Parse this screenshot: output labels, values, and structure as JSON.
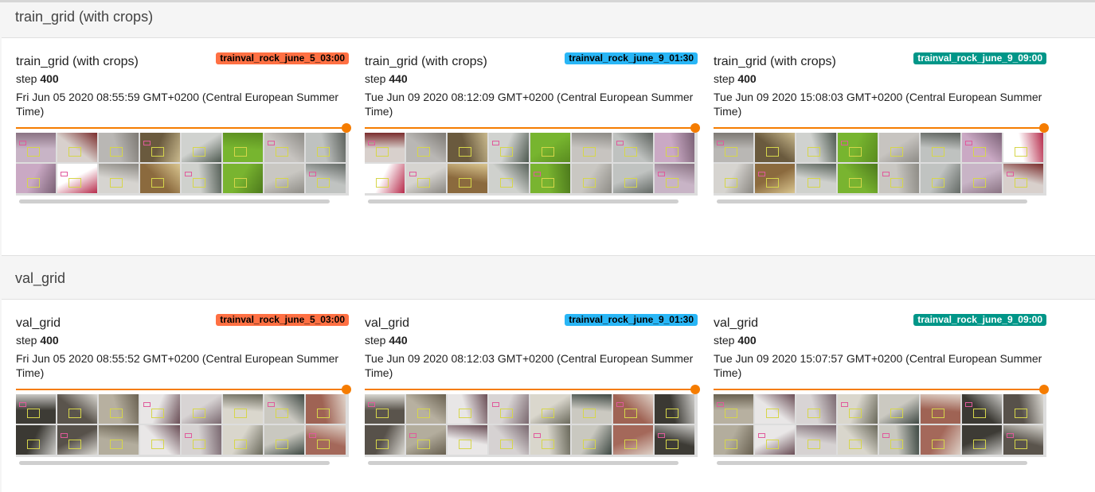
{
  "colors": {
    "accent": "#f57c00",
    "run_june_5": "#ff7043",
    "run_june_9_0130": "#29b6f6",
    "run_june_9_0900": "#009688"
  },
  "sections": [
    {
      "header": "train_grid (with crops)",
      "cards": [
        {
          "title": "train_grid (with crops)",
          "run": "trainval_rock_june_5_03:00",
          "run_color": "#ff7043",
          "run_text_color": "#000000",
          "step_label": "step",
          "step": "400",
          "time": "Fri Jun 05 2020 08:55:59 GMT+0200 (Central European Summer Time)",
          "slider_fraction": 1.0
        },
        {
          "title": "train_grid (with crops)",
          "run": "trainval_rock_june_9_01:30",
          "run_color": "#29b6f6",
          "run_text_color": "#000000",
          "step_label": "step",
          "step": "440",
          "time": "Tue Jun 09 2020 08:12:09 GMT+0200 (Central European Summer Time)",
          "slider_fraction": 1.0
        },
        {
          "title": "train_grid (with crops)",
          "run": "trainval_rock_june_9_09:00",
          "run_color": "#009688",
          "run_text_color": "#ffffff",
          "step_label": "step",
          "step": "400",
          "time": "Tue Jun 09 2020 15:08:03 GMT+0200 (Central European Summer Time)",
          "slider_fraction": 1.0
        }
      ]
    },
    {
      "header": "val_grid",
      "cards": [
        {
          "title": "val_grid",
          "run": "trainval_rock_june_5_03:00",
          "run_color": "#ff7043",
          "run_text_color": "#000000",
          "step_label": "step",
          "step": "400",
          "time": "Fri Jun 05 2020 08:55:52 GMT+0200 (Central European Summer Time)",
          "slider_fraction": 1.0
        },
        {
          "title": "val_grid",
          "run": "trainval_rock_june_9_01:30",
          "run_color": "#29b6f6",
          "run_text_color": "#000000",
          "step_label": "step",
          "step": "440",
          "time": "Tue Jun 09 2020 08:12:03 GMT+0200 (Central European Summer Time)",
          "slider_fraction": 1.0
        },
        {
          "title": "val_grid",
          "run": "trainval_rock_june_9_09:00",
          "run_color": "#009688",
          "run_text_color": "#ffffff",
          "step_label": "step",
          "step": "400",
          "time": "Tue Jun 09 2020 15:07:57 GMT+0200 (Central European Summer Time)",
          "slider_fraction": 1.0
        }
      ]
    }
  ]
}
